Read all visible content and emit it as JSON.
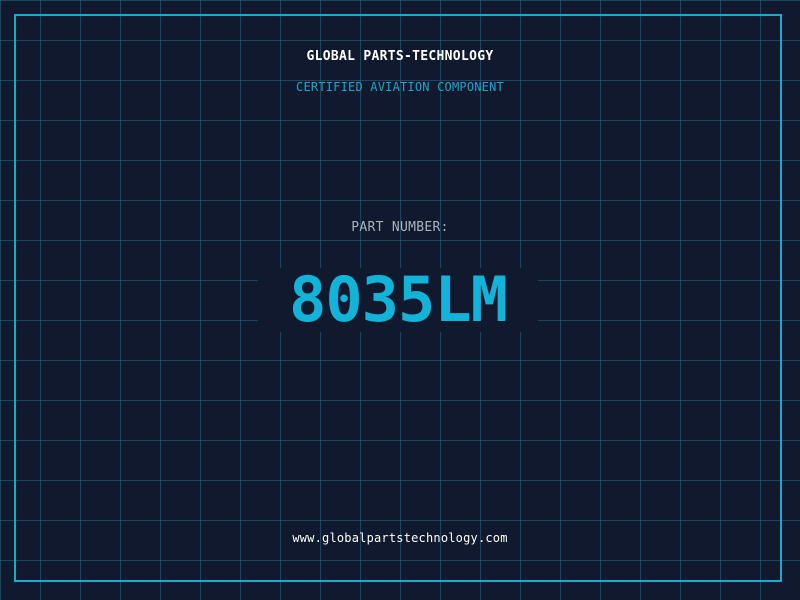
{
  "header": {
    "company": "GLOBAL PARTS-TECHNOLOGY",
    "subtitle": "CERTIFIED AVIATION COMPONENT"
  },
  "part": {
    "label": "PART NUMBER:",
    "number": "8035LM"
  },
  "footer": {
    "website": "www.globalpartstechnology.com"
  },
  "colors": {
    "background": "#10192d",
    "grid": "#1d6f8c",
    "accent": "#12b3d8",
    "label": "#a9b2c0",
    "text": "#ffffff"
  }
}
